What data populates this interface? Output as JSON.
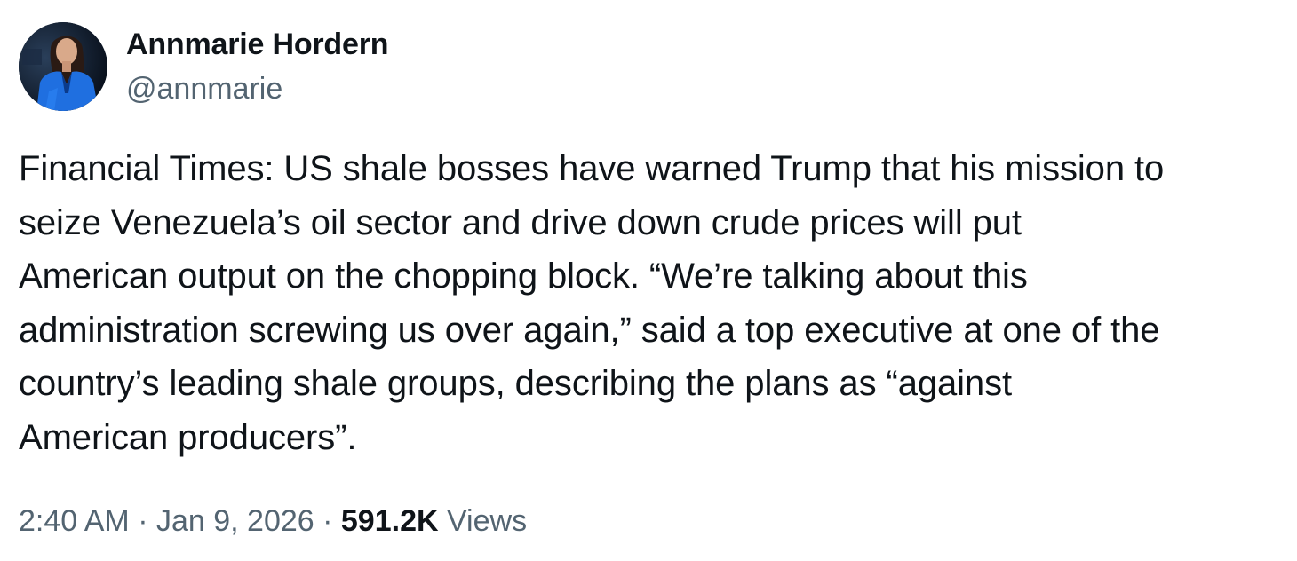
{
  "author": {
    "display_name": "Annmarie Hordern",
    "handle": "@annmarie",
    "avatar_icon": "profile-photo-avatar"
  },
  "tweet": {
    "text": "Financial Times: US shale bosses have warned Trump that his mission to\nseize Venezuela’s oil sector and drive down crude prices will put\nAmerican output on the chopping block. “We’re talking about this\nadministration screwing us over again,” said a top executive at one of the\ncountry’s leading shale groups, describing the plans as “against\nAmerican producers”."
  },
  "meta": {
    "time": "2:40 AM",
    "separator": " · ",
    "date": "Jan 9, 2026",
    "views_count": "591.2K",
    "views_label": "Views"
  },
  "colors": {
    "text_primary": "#0f1419",
    "text_secondary": "#536471",
    "background": "#ffffff"
  }
}
